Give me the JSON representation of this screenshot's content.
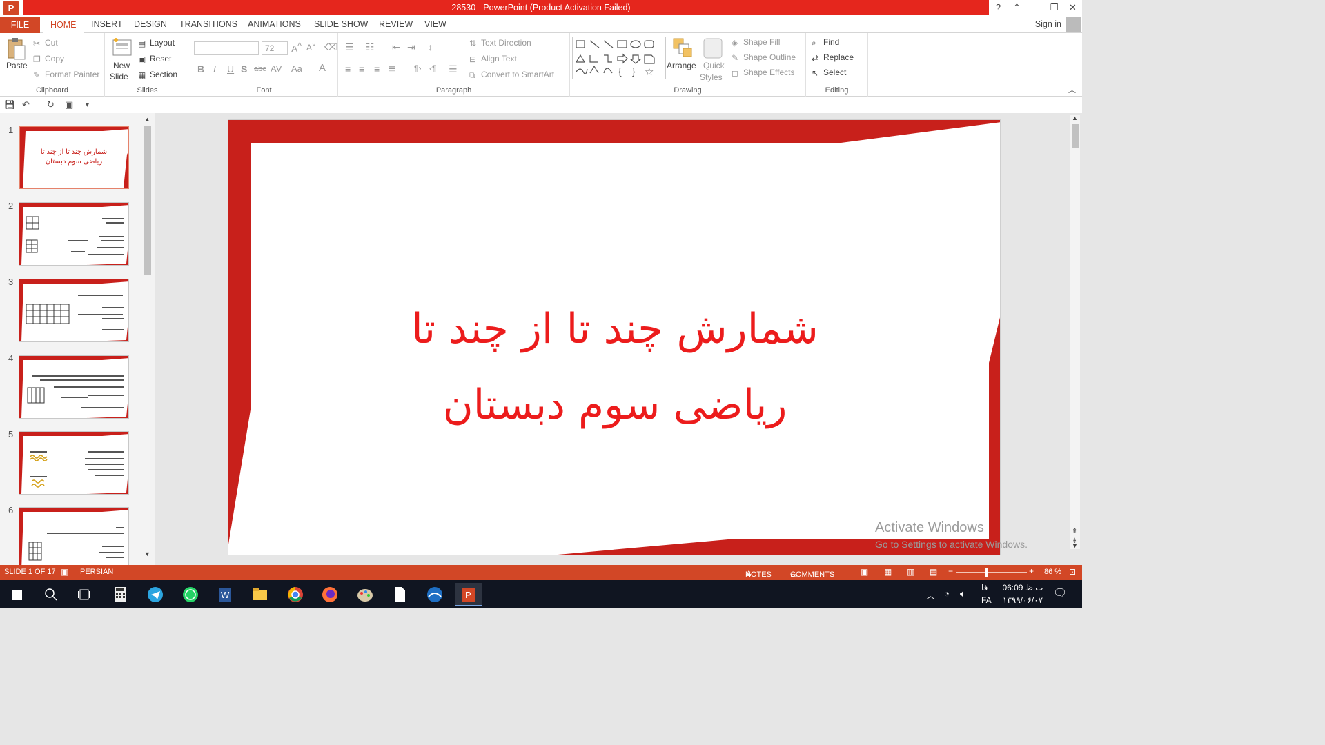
{
  "window": {
    "title": "28530 -  PowerPoint (Product Activation Failed)",
    "app_icon": "P"
  },
  "window_controls": {
    "help": "?",
    "restore_ribbon": "⌃",
    "minimize": "—",
    "restore": "❐",
    "close": "✕"
  },
  "tabs": [
    {
      "label": "FILE"
    },
    {
      "label": "HOME"
    },
    {
      "label": "INSERT"
    },
    {
      "label": "DESIGN"
    },
    {
      "label": "TRANSITIONS"
    },
    {
      "label": "ANIMATIONS"
    },
    {
      "label": "SLIDE SHOW"
    },
    {
      "label": "REVIEW"
    },
    {
      "label": "VIEW"
    }
  ],
  "signin": "Sign in",
  "ribbon": {
    "clipboard": {
      "label": "Clipboard",
      "paste": "Paste",
      "cut": "Cut",
      "copy": "Copy",
      "format_painter": "Format Painter"
    },
    "slides": {
      "label": "Slides",
      "new_slide_1": "New",
      "new_slide_2": "Slide",
      "layout": "Layout",
      "reset": "Reset",
      "section": "Section"
    },
    "font": {
      "label": "Font",
      "font_size": "72"
    },
    "paragraph": {
      "label": "Paragraph",
      "text_direction": "Text Direction",
      "align_text": "Align Text",
      "convert_smartart": "Convert to SmartArt"
    },
    "drawing": {
      "label": "Drawing",
      "arrange": "Arrange",
      "quick_styles_1": "Quick",
      "quick_styles_2": "Styles",
      "shape_fill": "Shape Fill",
      "shape_outline": "Shape Outline",
      "shape_effects": "Shape Effects"
    },
    "editing": {
      "label": "Editing",
      "find": "Find",
      "replace": "Replace",
      "select": "Select"
    }
  },
  "thumbnails": [
    {
      "num": "1",
      "line1": "شمارش چند تا از چند تا",
      "line2": "ریاضی سوم دبستان"
    },
    {
      "num": "2"
    },
    {
      "num": "3"
    },
    {
      "num": "4"
    },
    {
      "num": "5"
    },
    {
      "num": "6"
    }
  ],
  "slide": {
    "title_line1": "شمارش چند تا از چند تا",
    "title_line2": "ریاضی سوم دبستان"
  },
  "watermark": {
    "line1": "Activate Windows",
    "line2": "Go to Settings to activate Windows."
  },
  "status": {
    "slide_info": "SLIDE 1 OF 17",
    "language": "PERSIAN",
    "notes": "NOTES",
    "comments": "COMMENTS",
    "zoom": "86 %"
  },
  "taskbar": {
    "time": "06:09 ب.ظ",
    "date": "۱۳۹۹/۰۶/۰۷",
    "lang_top": "فا",
    "lang_bottom": "FA"
  },
  "colors": {
    "accent": "#d24726",
    "title_bar": "#e5261d",
    "slide_red": "#c8201b",
    "title_text": "#ec1c1c"
  }
}
